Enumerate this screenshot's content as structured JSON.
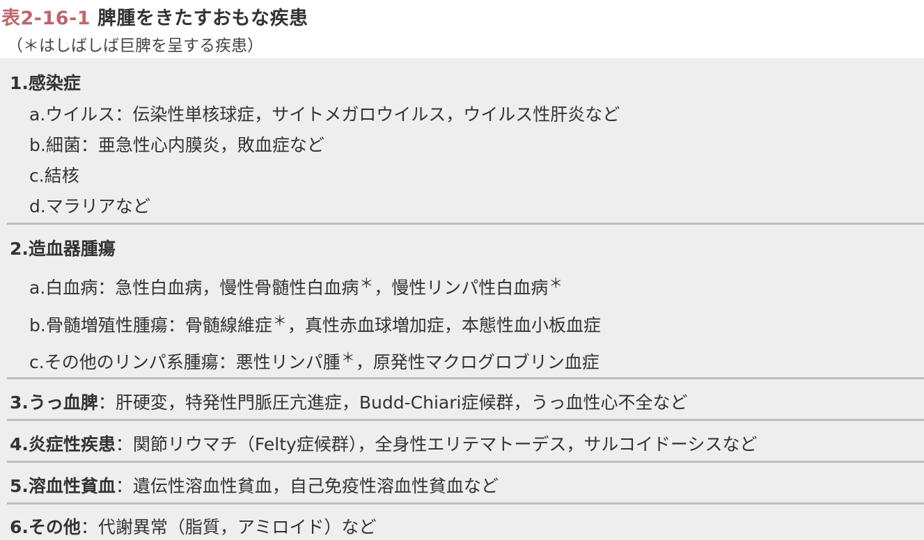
{
  "title": {
    "number": "表2-16-1",
    "text": "脾腫をきたすおもな疾患"
  },
  "subtitle": "（＊はしばしば巨脾を呈する疾患）",
  "sections": [
    {
      "heading": "1.感染症",
      "items": [
        "a.ウイルス：伝染性単核球症，サイトメガロウイルス，ウイルス性肝炎など",
        "b.細菌：亜急性心内膜炎，敗血症など",
        "c.結核",
        "d.マラリアなど"
      ]
    },
    {
      "heading": "2.造血器腫瘍",
      "items": [
        {
          "a": "a.白血病：急性白血病，慢性骨髄性白血病",
          "s1": "＊",
          "b": "，慢性リンパ性白血病",
          "s2": "＊"
        },
        {
          "a": "b.骨髄増殖性腫瘍：骨髄線維症",
          "s1": "＊",
          "b": "，真性赤血球増加症，本態性血小板血症"
        },
        {
          "a": "c.その他のリンパ系腫瘍：悪性リンパ腫",
          "s1": "＊",
          "b": "，原発性マクログロブリン血症"
        }
      ]
    },
    {
      "heading": "3.うっ血脾",
      "text": "：肝硬変，特発性門脈圧亢進症，Budd-Chiari症候群，うっ血性心不全など"
    },
    {
      "heading": "4.炎症性疾患",
      "text": "：関節リウマチ（Felty症候群），全身性エリテマトーデス，サルコイドーシスなど"
    },
    {
      "heading": "5.溶血性貧血",
      "text": "：遺伝性溶血性貧血，自己免疫性溶血性貧血など"
    },
    {
      "heading": "6.その他",
      "text": "：代謝異常（脂質，アミロイド）など"
    }
  ]
}
